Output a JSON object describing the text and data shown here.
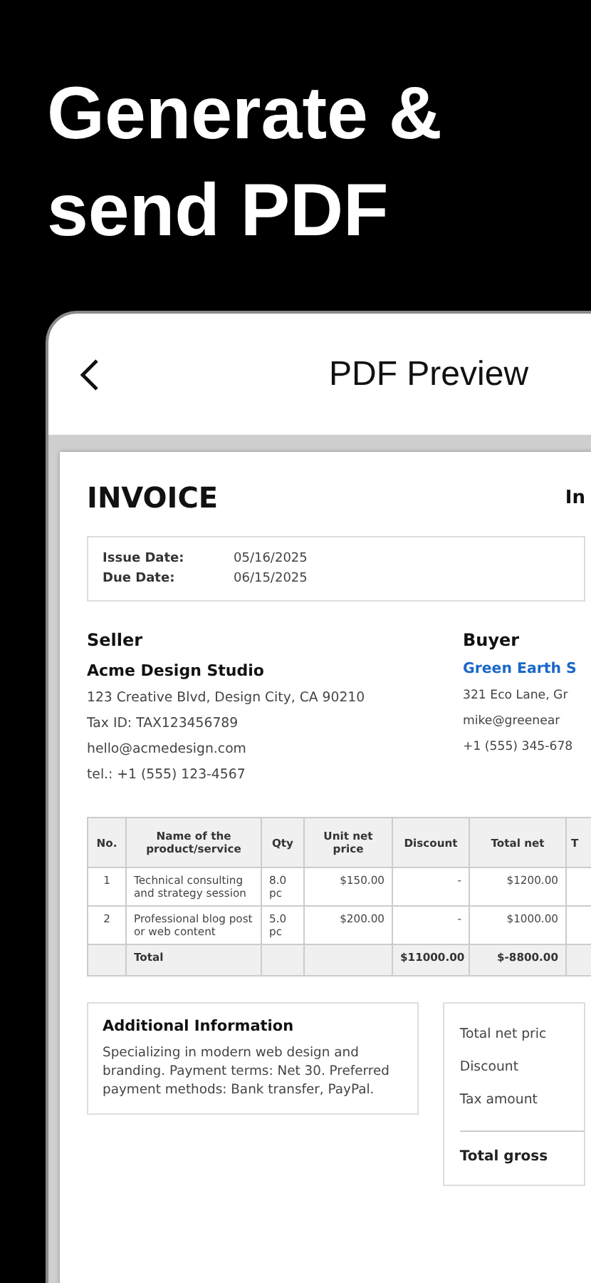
{
  "headline": "Generate & send PDF",
  "screen": {
    "title": "PDF Preview"
  },
  "invoice": {
    "title": "INVOICE",
    "title_right": "In",
    "dates": [
      {
        "label": "Issue Date:",
        "value": "05/16/2025"
      },
      {
        "label": "Due Date:",
        "value": "06/15/2025"
      }
    ],
    "seller": {
      "heading": "Seller",
      "name": "Acme Design Studio",
      "lines": [
        "123 Creative Blvd, Design City, CA 90210",
        "Tax ID: TAX123456789",
        "hello@acmedesign.com",
        "tel.: +1 (555) 123-4567"
      ]
    },
    "buyer": {
      "heading": "Buyer",
      "name": "Green Earth S",
      "lines": [
        "321 Eco Lane, Gr",
        "mike@greenear",
        "+1 (555) 345-678"
      ]
    },
    "table": {
      "columns": [
        "No.",
        "Name of the product/service",
        "Qty",
        "Unit net price",
        "Discount",
        "Total net",
        "T"
      ],
      "rows": [
        [
          "1",
          "Technical consulting and strategy session",
          "8.0 pc",
          "$150.00",
          "-",
          "$1200.00"
        ],
        [
          "2",
          "Professional blog post or web content",
          "5.0 pc",
          "$200.00",
          "-",
          "$1000.00"
        ]
      ],
      "total_row": {
        "label": "Total",
        "discount": "$11000.00",
        "total_net": "$-8800.00"
      }
    },
    "additional": {
      "heading": "Additional Information",
      "text": "Specializing in modern web design and branding. Payment terms: Net 30. Preferred payment methods: Bank transfer, PayPal."
    },
    "totals": [
      "Total net pric",
      "Discount",
      "Tax amount"
    ],
    "total_gross": "Total gross"
  }
}
